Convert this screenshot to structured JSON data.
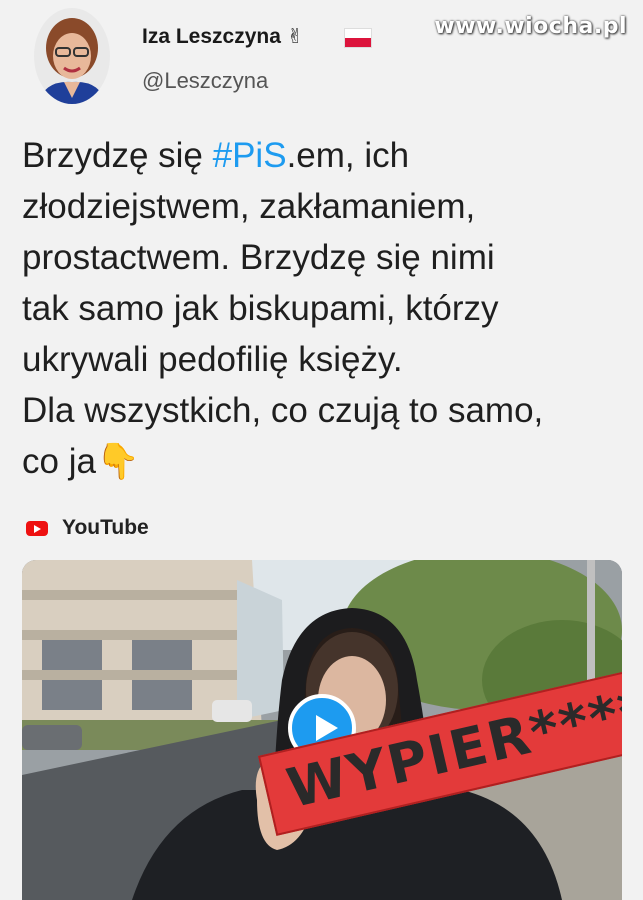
{
  "watermark": "www.wiocha.pl",
  "author": {
    "name": "Iza Leszczyna",
    "emoji": "✌",
    "handle": "@Leszczyna"
  },
  "tweet": {
    "line1_pre": "Brzydzę się ",
    "line1_hashtag": "#PiS",
    "line1_post": ".em, ich",
    "line2": "złodziejstwem, zakłamaniem,",
    "line3": "prostactwem. Brzydzę się nimi",
    "line4": "tak samo jak biskupami, którzy",
    "line5": "ukrywali pedofilię księży.",
    "line6": "Dla wszystkich, co czują to samo,",
    "line7": "co ja",
    "line7_emoji": "👇"
  },
  "video": {
    "source_label": "YouTube",
    "banner_text": "WYPIER****"
  },
  "colors": {
    "hashtag": "#1d9bf0",
    "play_button": "#1d9bf0",
    "youtube_red": "#e11111",
    "banner_red": "#e33a3a"
  },
  "icons": {
    "source": "youtube-icon",
    "play": "play-icon",
    "flag": "poland-flag-icon"
  }
}
